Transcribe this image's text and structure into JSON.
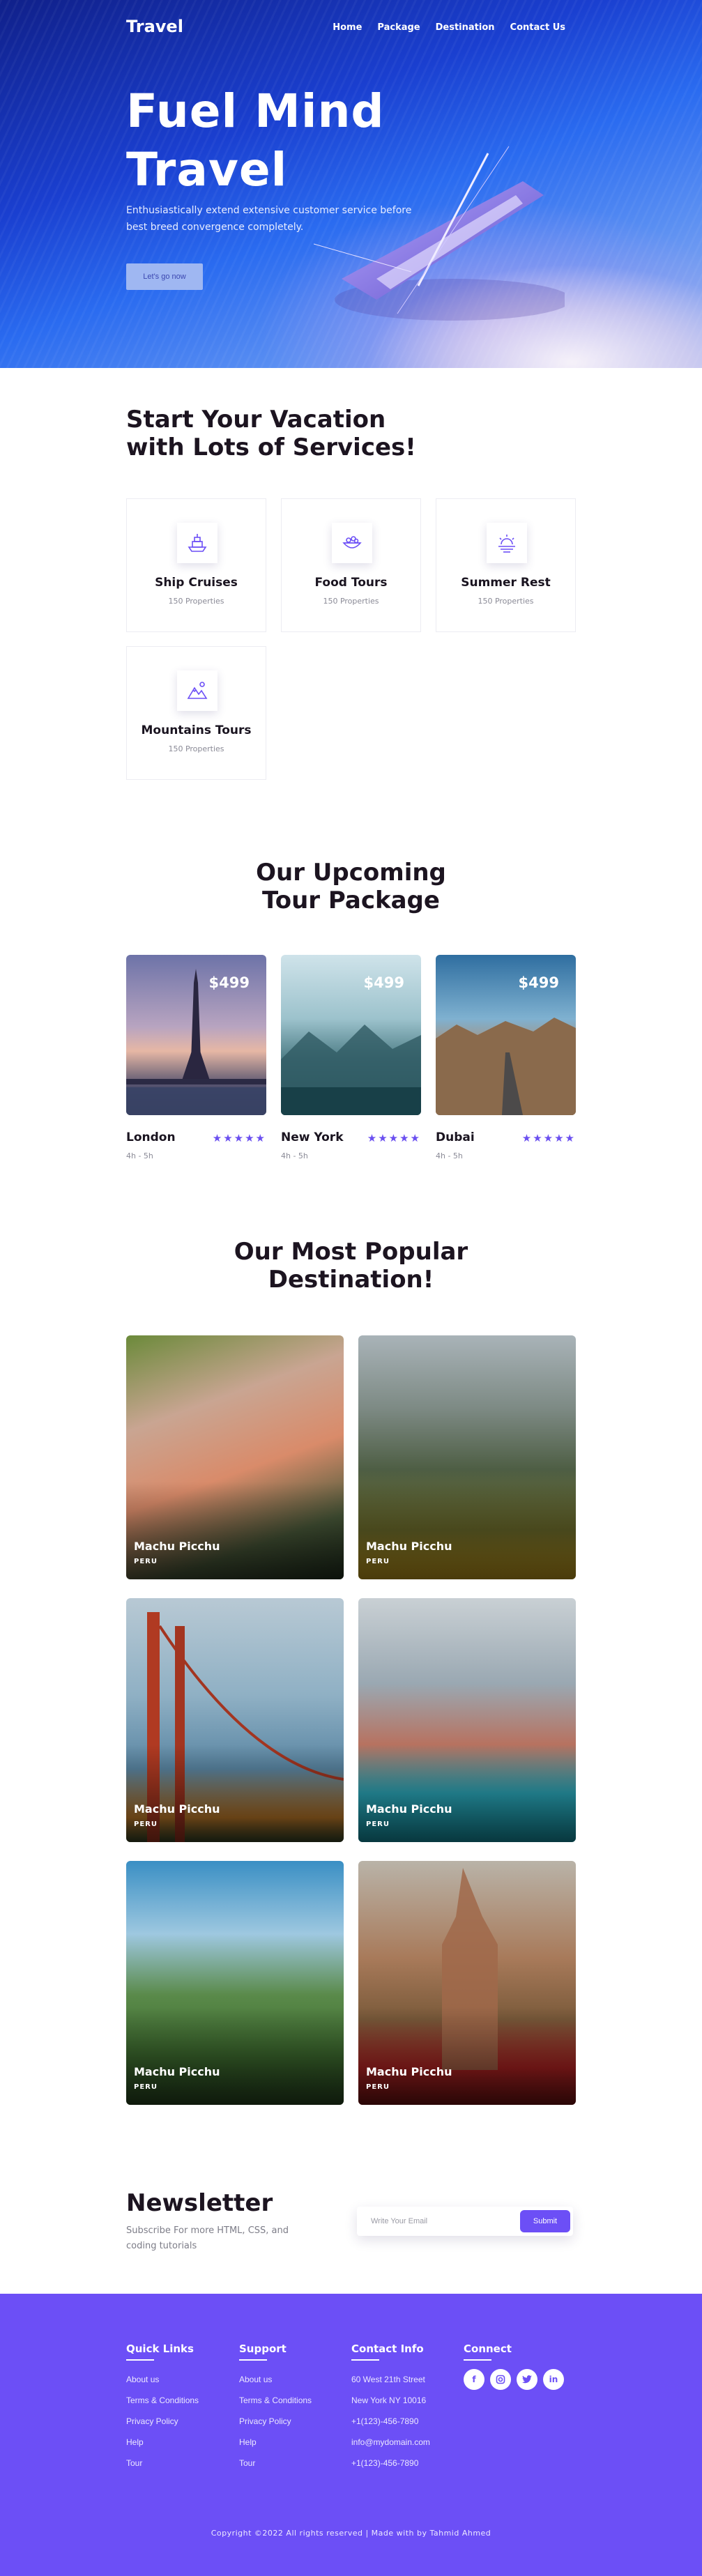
{
  "nav": {
    "brand": "Travel",
    "links": [
      "Home",
      "Package",
      "Destination",
      "Contact Us"
    ]
  },
  "hero": {
    "title_line1": "Fuel Mind",
    "title_line2": "Travel",
    "subtitle": "Enthusiastically extend extensive customer service before best breed convergence completely.",
    "button": "Let's go now"
  },
  "services": {
    "title_line1": "Start Your Vacation",
    "title_line2": "with Lots of Services!",
    "items": [
      {
        "title": "Ship Cruises",
        "sub": "150 Properties",
        "icon": "ship-icon"
      },
      {
        "title": "Food Tours",
        "sub": "150 Properties",
        "icon": "food-icon"
      },
      {
        "title": "Summer Rest",
        "sub": "150 Properties",
        "icon": "sunset-icon"
      },
      {
        "title": "Mountains Tours",
        "sub": "150 Properties",
        "icon": "mountain-icon"
      }
    ]
  },
  "tours": {
    "title_line1": "Our Upcoming",
    "title_line2": "Tour Package",
    "items": [
      {
        "city": "London",
        "price": "$499",
        "duration": "4h - 5h",
        "rating": 5
      },
      {
        "city": "New York",
        "price": "$499",
        "duration": "4h - 5h",
        "rating": 5
      },
      {
        "city": "Dubai",
        "price": "$499",
        "duration": "4h - 5h",
        "rating": 5
      }
    ]
  },
  "destinations": {
    "title_line1": "Our Most Popular",
    "title_line2": "Destination!",
    "items": [
      {
        "name": "Machu Picchu",
        "country": "PERU"
      },
      {
        "name": "Machu Picchu",
        "country": "PERU"
      },
      {
        "name": "Machu Picchu",
        "country": "PERU"
      },
      {
        "name": "Machu Picchu",
        "country": "PERU"
      },
      {
        "name": "Machu Picchu",
        "country": "PERU"
      },
      {
        "name": "Machu Picchu",
        "country": "PERU"
      }
    ]
  },
  "newsletter": {
    "title": "Newsletter",
    "subtitle": "Subscribe For more HTML, CSS, and coding tutorials",
    "placeholder": "Write Your Email",
    "button": "Submit"
  },
  "footer": {
    "quick_links": {
      "title": "Quick Links",
      "links": [
        "About us",
        "Terms & Conditions",
        "Privacy Policy",
        "Help",
        "Tour"
      ]
    },
    "support": {
      "title": "Support",
      "links": [
        "About us",
        "Terms & Conditions",
        "Privacy Policy",
        "Help",
        "Tour"
      ]
    },
    "contact": {
      "title": "Contact Info",
      "lines": [
        "60 West 21th Street",
        "New York NY 10016",
        "+1(123)-456-7890",
        "info@mydomain.com",
        "+1(123)-456-7890"
      ]
    },
    "connect": {
      "title": "Connect",
      "socials": [
        "facebook-icon",
        "instagram-icon",
        "twitter-icon",
        "linkedin-icon"
      ]
    },
    "copyright": "Copyright ©2022 All rights reserved | Made with by Tahmid Ahmed"
  },
  "colors": {
    "accent": "#6c4ff6",
    "heading": "#1c1420",
    "hero_blue": "#1a3fd0"
  }
}
